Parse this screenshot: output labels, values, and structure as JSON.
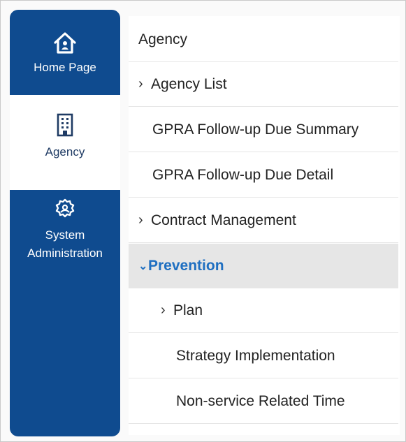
{
  "rail": {
    "items": [
      {
        "label": "Home Page",
        "icon": "home-icon"
      },
      {
        "label": "Agency",
        "icon": "building-icon",
        "selected": true
      },
      {
        "label_line1": "System",
        "label_line2": "Administration",
        "icon": "gear-icon"
      }
    ]
  },
  "submenu": {
    "title": "Agency",
    "items": [
      {
        "label": "Agency List",
        "expandable": true,
        "expanded": false
      },
      {
        "label": "GPRA Follow-up Due Summary"
      },
      {
        "label": "GPRA Follow-up Due Detail"
      },
      {
        "label": "Contract Management",
        "expandable": true,
        "expanded": false
      },
      {
        "label": "Prevention",
        "expandable": true,
        "expanded": true,
        "selected": true
      },
      {
        "label": "Plan",
        "expandable": true,
        "expanded": false
      },
      {
        "label": "Strategy Implementation"
      },
      {
        "label": "Non-service Related Time"
      }
    ]
  },
  "colors": {
    "rail_bg": "#0f4b8f",
    "selected_text": "#1f6fc1",
    "selected_row_bg": "#e6e6e6"
  }
}
